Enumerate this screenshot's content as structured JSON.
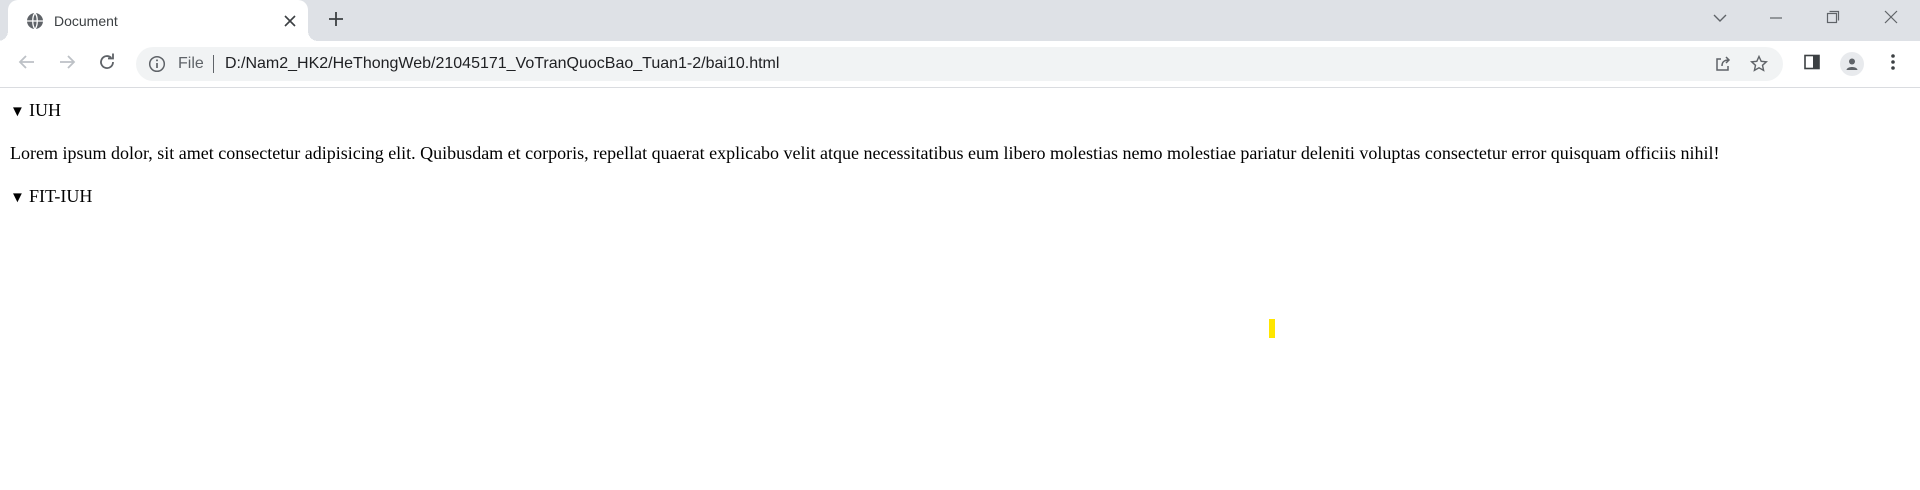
{
  "browser": {
    "tab": {
      "title": "Document",
      "favicon_icon": "globe-icon",
      "close_icon": "close-icon"
    },
    "new_tab_icon": "plus-icon",
    "window_controls": [
      "chevron-down-icon",
      "minimize-icon",
      "restore-icon",
      "close-icon"
    ],
    "toolbar": {
      "back_icon": "arrow-left-icon",
      "forward_icon": "arrow-right-icon",
      "reload_icon": "reload-icon",
      "omnibox": {
        "info_icon": "info-icon",
        "scheme_label": "File",
        "url": "D:/Nam2_HK2/HeThongWeb/21045171_VoTranQuocBao_Tuan1-2/bai10.html",
        "share_icon": "share-icon",
        "bookmark_icon": "star-icon"
      },
      "side_panel_icon": "side-panel-icon",
      "profile_icon": "person-icon",
      "menu_icon": "more-vert-icon"
    }
  },
  "page": {
    "details": [
      {
        "marker": "▼",
        "summary": "IUH",
        "open": true
      },
      {
        "marker": "▼",
        "summary": "FIT-IUH",
        "open": true
      }
    ],
    "paragraph": "Lorem ipsum dolor, sit amet consectetur adipisicing elit. Quibusdam et corporis, repellat quaerat explicabo velit atque necessitatibus eum libero molestias nemo molestiae pariatur deleniti voluptas consectetur error quisquam officiis nihil!"
  },
  "colors": {
    "tabstrip": "#dee1e6",
    "omnibox": "#f1f3f4",
    "icon": "#5f6368",
    "cursor_highlight": "#ffe600"
  }
}
